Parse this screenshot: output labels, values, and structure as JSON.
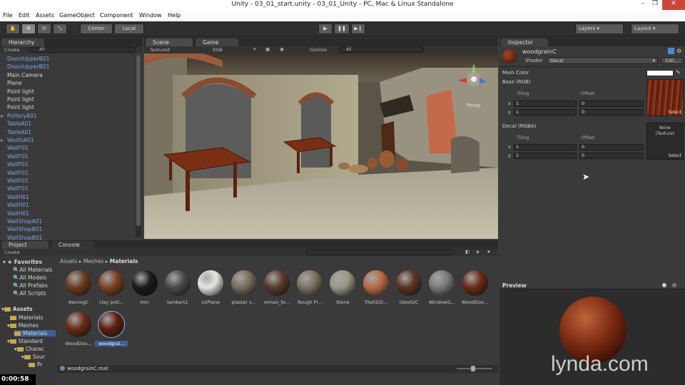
{
  "window": {
    "title": "Unity - 03_01_start.unity - 03_01_Unity - PC, Mac & Linux Standalone",
    "minimize": "–",
    "maximize": "❐",
    "close": "✕"
  },
  "menu": [
    "File",
    "Edit",
    "Assets",
    "GameObject",
    "Component",
    "Window",
    "Help"
  ],
  "toolbar": {
    "pivot": "Center",
    "space": "Local",
    "layers": "Layers",
    "layout": "Layout"
  },
  "hierarchy": {
    "tab": "Hierarchy",
    "create": "Create",
    "search": "All",
    "items": [
      {
        "label": "DoorsUpperB01",
        "color": "blue",
        "arrow": false
      },
      {
        "label": "DoorsUpperB01",
        "color": "blue",
        "arrow": false
      },
      {
        "label": "Main Camera",
        "color": "white",
        "arrow": false
      },
      {
        "label": "Plane",
        "color": "white",
        "arrow": false
      },
      {
        "label": "Point light",
        "color": "white",
        "arrow": false
      },
      {
        "label": "Point light",
        "color": "white",
        "arrow": false
      },
      {
        "label": "Point light",
        "color": "white",
        "arrow": false
      },
      {
        "label": "PotteryA01",
        "color": "blue",
        "arrow": true
      },
      {
        "label": "TableA01",
        "color": "blue",
        "arrow": false
      },
      {
        "label": "TableA01",
        "color": "blue",
        "arrow": false
      },
      {
        "label": "VaultsA01",
        "color": "blue",
        "arrow": true
      },
      {
        "label": "WallF01",
        "color": "blue",
        "arrow": false
      },
      {
        "label": "WallF01",
        "color": "blue",
        "arrow": false
      },
      {
        "label": "WallF01",
        "color": "blue",
        "arrow": false
      },
      {
        "label": "WallF01",
        "color": "blue",
        "arrow": false
      },
      {
        "label": "WallF01",
        "color": "blue",
        "arrow": false
      },
      {
        "label": "WallF01",
        "color": "blue",
        "arrow": false
      },
      {
        "label": "WallH01",
        "color": "blue",
        "arrow": false
      },
      {
        "label": "WallH01",
        "color": "blue",
        "arrow": false
      },
      {
        "label": "WallH01",
        "color": "blue",
        "arrow": false
      },
      {
        "label": "WallShopA01",
        "color": "blue",
        "arrow": false
      },
      {
        "label": "WallShopB01",
        "color": "blue",
        "arrow": false
      },
      {
        "label": "WallShopB01",
        "color": "blue",
        "arrow": false
      }
    ]
  },
  "scene": {
    "tab_scene": "Scene",
    "tab_game": "Game",
    "render_mode": "Textured",
    "color_mode": "RGB",
    "gizmos": "Gizmos",
    "search": "All",
    "persp": "Persp"
  },
  "inspector": {
    "tab": "Inspector",
    "material": "woodgrainC",
    "shader_label": "Shader",
    "shader_value": "Decal",
    "edit": "Edit...",
    "main_color": "Main Color",
    "base": "Base (RGB)",
    "decal": "Decal (RGBA)",
    "tiling": "Tiling",
    "offset": "Offset",
    "x": "x",
    "y": "y",
    "base_tiling_x": "1",
    "base_tiling_y": "1",
    "base_offset_x": "0",
    "base_offset_y": "0",
    "decal_tiling_x": "1",
    "decal_tiling_y": "1",
    "decal_offset_x": "0",
    "decal_offset_y": "0",
    "select": "Select",
    "none_texture": "None\n(Texture)"
  },
  "project": {
    "tab_project": "Project",
    "tab_console": "Console",
    "create": "Create",
    "breadcrumb": [
      "Assets",
      "Meshes",
      "Materials"
    ],
    "favorites_title": "Favorites",
    "favorites": [
      "All Materials",
      "All Models",
      "All Prefabs",
      "All Scripts"
    ],
    "assets_title": "Assets",
    "tree": [
      "Materials",
      "Meshes",
      "Materials",
      "Standard",
      "Charac",
      "Sour",
      "Pr"
    ],
    "assets": [
      {
        "label": "AwningC",
        "color": "#6b3d1f"
      },
      {
        "label": "clay pott...",
        "color": "#7a4024"
      },
      {
        "label": "Iron",
        "color": "#1a1a1a"
      },
      {
        "label": "lambert1",
        "color": "#4a4a4a"
      },
      {
        "label": "LitPlane",
        "color": "#e8e6e0"
      },
      {
        "label": "plaster v...",
        "color": "#756d5c"
      },
      {
        "label": "roman_br...",
        "color": "#5a3a2a"
      },
      {
        "label": "Rough Pl...",
        "color": "#7a7260"
      },
      {
        "label": "Stone",
        "color": "#9a9888"
      },
      {
        "label": "Tile02Gl...",
        "color": "#b86a48"
      },
      {
        "label": "tiles02C",
        "color": "#5a3424"
      },
      {
        "label": "WindowG...",
        "color": "#7a7a7a"
      },
      {
        "label": "WoodDoo...",
        "color": "#6a2a18"
      },
      {
        "label": "WoodDoo...",
        "color": "#6a2a18"
      },
      {
        "label": "woodgrai...",
        "color": "#5e2012"
      }
    ],
    "status": "woodgrainC.mat"
  },
  "preview": {
    "title": "Preview"
  },
  "watermark": "lynda.com",
  "timer": "0:00:58"
}
